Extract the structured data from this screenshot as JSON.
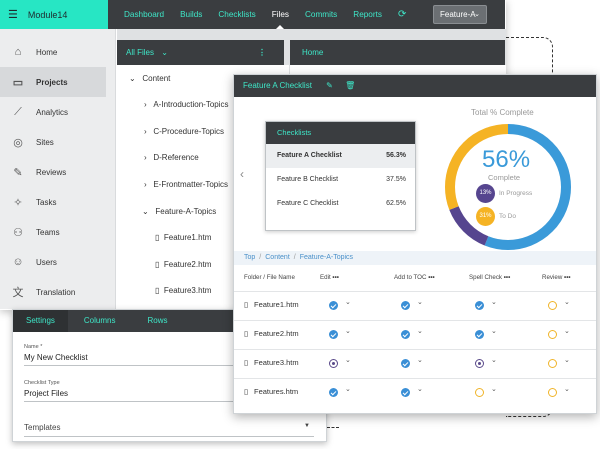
{
  "app": {
    "module": "Module14"
  },
  "nav": {
    "items": [
      "Dashboard",
      "Builds",
      "Checklists",
      "Files",
      "Commits",
      "Reports"
    ],
    "active": "Files",
    "feature_select": "Feature-A"
  },
  "sidebar": {
    "items": [
      {
        "label": "Home",
        "icon": "home-icon"
      },
      {
        "label": "Projects",
        "icon": "folder-icon"
      },
      {
        "label": "Analytics",
        "icon": "chart-icon"
      },
      {
        "label": "Sites",
        "icon": "globe-icon"
      },
      {
        "label": "Reviews",
        "icon": "pencil-icon"
      },
      {
        "label": "Tasks",
        "icon": "pin-icon"
      },
      {
        "label": "Teams",
        "icon": "users-icon"
      },
      {
        "label": "Users",
        "icon": "user-icon"
      },
      {
        "label": "Translation",
        "icon": "translate-icon"
      }
    ],
    "selected": "Projects"
  },
  "files_panel": {
    "title": "All Files",
    "tree": [
      {
        "label": "Content",
        "type": "expanded"
      },
      {
        "label": "A-Introduction-Topics",
        "type": "collapsed"
      },
      {
        "label": "C-Procedure-Topics",
        "type": "collapsed"
      },
      {
        "label": "D-Reference",
        "type": "collapsed"
      },
      {
        "label": "E-Frontmatter-Topics",
        "type": "collapsed"
      },
      {
        "label": "Feature-A-Topics",
        "type": "expanded"
      },
      {
        "label": "Feature1.htm",
        "type": "file"
      },
      {
        "label": "Feature2.htm",
        "type": "file"
      },
      {
        "label": "Feature3.htm",
        "type": "file"
      }
    ]
  },
  "home_panel": {
    "title": "Home"
  },
  "settings": {
    "tabs": [
      "Settings",
      "Columns",
      "Rows"
    ],
    "name_label": "Name *",
    "name_value": "My New Checklist",
    "type_label": "Checklist Type",
    "type_value": "Project Files",
    "templates_label": "Templates"
  },
  "modal": {
    "title": "Feature A Checklist",
    "checklists_header": "Checklists",
    "checklists": [
      {
        "name": "Feature A Checklist",
        "pct": "56.3%"
      },
      {
        "name": "Feature B Checklist",
        "pct": "37.5%"
      },
      {
        "name": "Feature C Checklist",
        "pct": "62.5%"
      }
    ],
    "donut": {
      "title": "Total % Complete",
      "percent_text": "56%",
      "complete_label": "Complete",
      "in_progress_badge": "13%",
      "in_progress_label": "In Progress",
      "todo_badge": "31%",
      "todo_label": "To Do",
      "complete_value": 56,
      "in_progress_value": 13,
      "todo_value": 31,
      "colors": {
        "complete": "#3a9ad9",
        "in_progress": "#56458f",
        "todo": "#f5b324"
      }
    },
    "breadcrumb": [
      "Top",
      "Content",
      "Feature-A-Topics"
    ],
    "columns": [
      "Folder / File Name",
      "Edit",
      "Add to TOC",
      "Spell Check",
      "Review"
    ],
    "rows": [
      {
        "name": "Feature1.htm",
        "status": [
          "done",
          "done",
          "done",
          "todo"
        ]
      },
      {
        "name": "Feature2.htm",
        "status": [
          "done",
          "done",
          "done",
          "todo"
        ]
      },
      {
        "name": "Feature3.htm",
        "status": [
          "prog",
          "done",
          "prog",
          "todo"
        ]
      },
      {
        "name": "Features.htm",
        "status": [
          "done",
          "done",
          "todo",
          "todo"
        ]
      }
    ]
  }
}
